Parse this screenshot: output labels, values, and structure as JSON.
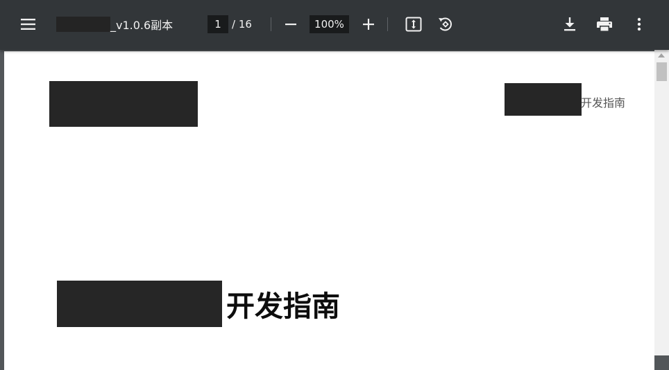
{
  "toolbar": {
    "title_suffix": "_v1.0.6副本",
    "page_current": "1",
    "page_total": "/ 16",
    "zoom": "100%",
    "icons": {
      "menu": "hamburger-menu-icon",
      "zoom_out": "minus-icon",
      "zoom_in": "plus-icon",
      "fit": "fit-to-page-icon",
      "rotate": "rotate-counterclockwise-icon",
      "download": "download-icon",
      "print": "print-icon",
      "more": "more-vertical-icon"
    }
  },
  "document": {
    "header_text": "开发指南",
    "title_text": "开发指南"
  },
  "colors": {
    "toolbar_bg": "#323639",
    "viewer_bg": "#525659",
    "redaction": "#262626"
  }
}
